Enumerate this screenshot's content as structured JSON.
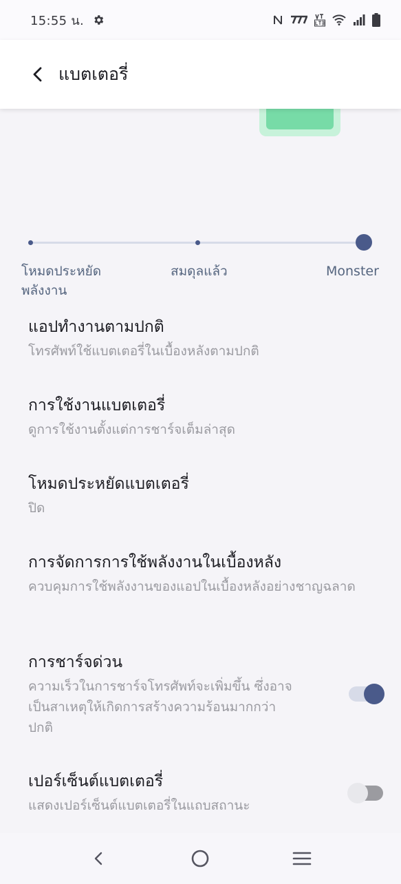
{
  "status_bar": {
    "time": "15:55 น.",
    "icons": [
      "gear-icon",
      "nfc-icon",
      "carrier-icon",
      "volte-icon",
      "wifi-icon",
      "signal-icon",
      "battery-icon"
    ]
  },
  "app_bar": {
    "title": "แบตเตอรี่",
    "back_icon": "back-arrow-icon"
  },
  "battery_modes": {
    "options": [
      "โหมดประหยัดพลังงาน",
      "สมดุลแล้ว",
      "Monster"
    ],
    "selected": "Monster",
    "save_label_line1": "โหมดประหยัด",
    "save_label_line2": "พลังงาน"
  },
  "settings": [
    {
      "title": "แอปทำงานตามปกติ",
      "subtitle": "โทรศัพท์ใช้แบตเตอรี่ในเบื้องหลังตามปกติ"
    },
    {
      "title": "การใช้งานแบตเตอรี่",
      "subtitle": "ดูการใช้งานตั้งแต่การชาร์จเต็มล่าสุด"
    },
    {
      "title": "โหมดประหยัดแบตเตอรี่",
      "subtitle": "ปิด"
    },
    {
      "title": "การจัดการการใช้พลังงานในเบื้องหลัง",
      "subtitle": "ควบคุมการใช้พลังงานของแอปในเบื้องหลังอย่างชาญฉลาด"
    },
    {
      "title": "การชาร์จด่วน",
      "subtitle": "ความเร็วในการชาร์จโทรศัพท์จะเพิ่มขึ้น ซึ่งอาจเป็นสาเหตุให้เกิดการสร้างความร้อนมากกว่าปกติ",
      "toggle": true
    },
    {
      "title": "เปอร์เซ็นต์แบตเตอรี่",
      "subtitle": "แสดงเปอร์เซ็นต์แบตเตอรี่ในแถบสถานะ",
      "toggle": false
    }
  ],
  "nav_bar": {
    "icons": [
      "nav-back-icon",
      "nav-home-icon",
      "nav-recents-icon"
    ]
  },
  "colors": {
    "accent": "#4a5a8a",
    "battery_fill": "#77dba7",
    "background": "#f5f4f8"
  }
}
